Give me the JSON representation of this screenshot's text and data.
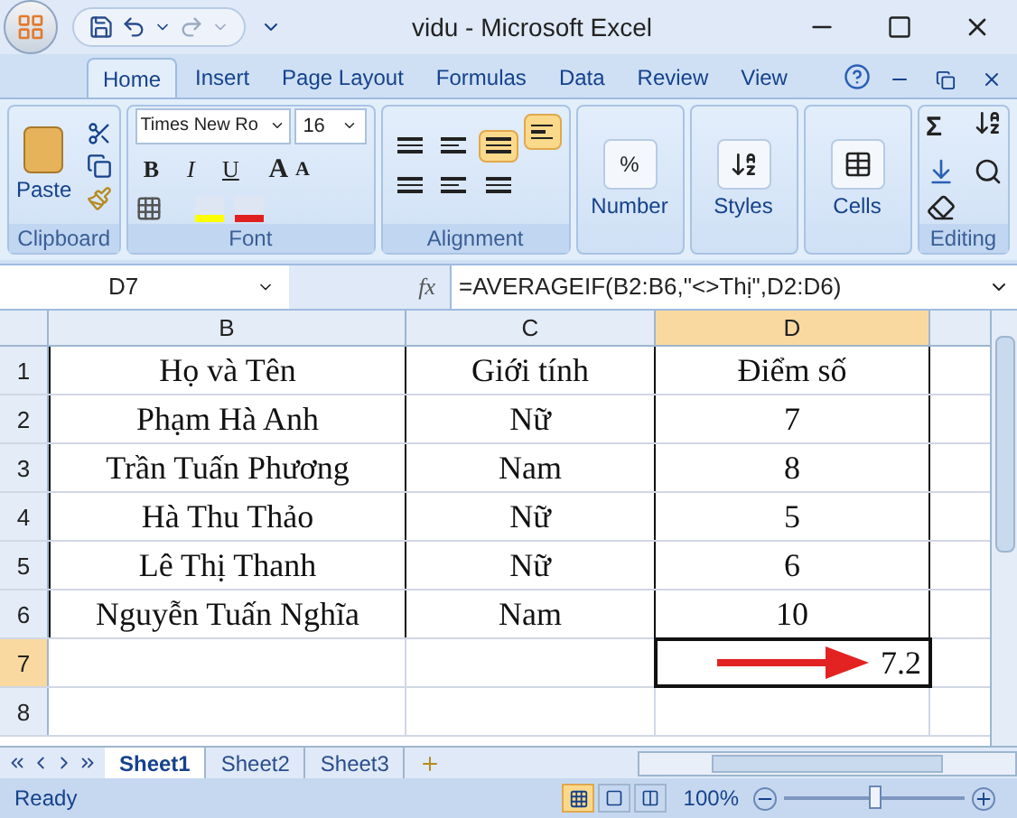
{
  "window": {
    "title": "vidu - Microsoft Excel"
  },
  "ribbon_tabs": [
    {
      "label": "Home",
      "selected": true
    },
    {
      "label": "Insert",
      "selected": false
    },
    {
      "label": "Page Layout",
      "selected": false
    },
    {
      "label": "Formulas",
      "selected": false
    },
    {
      "label": "Data",
      "selected": false
    },
    {
      "label": "Review",
      "selected": false
    },
    {
      "label": "View",
      "selected": false
    }
  ],
  "ribbon": {
    "clipboard": {
      "label": "Clipboard",
      "paste": "Paste"
    },
    "font": {
      "label": "Font",
      "font_name": "Times New Ro",
      "font_size": "16",
      "bold": "B",
      "italic": "I",
      "underline": "U",
      "grow": "A",
      "shrink": "A"
    },
    "alignment": {
      "label": "Alignment",
      "buttons": [
        {
          "selected": false
        },
        {
          "selected": false
        },
        {
          "selected": true
        },
        {
          "selected": false
        },
        {
          "selected": false
        },
        {
          "selected": false
        }
      ],
      "wrap_text": {
        "selected": true
      }
    },
    "number": {
      "label": "Number",
      "symbol": "%"
    },
    "styles": {
      "label": "Styles"
    },
    "cells": {
      "label": "Cells"
    },
    "editing": {
      "label": "Editing",
      "sum": "Σ"
    }
  },
  "formula_bar": {
    "name_box": "D7",
    "fx": "fx",
    "formula": "=AVERAGEIF(B2:B6,\"<>Thị\",D2:D6)"
  },
  "columns": [
    {
      "label": "B",
      "selected": false
    },
    {
      "label": "C",
      "selected": false
    },
    {
      "label": "D",
      "selected": true
    }
  ],
  "rows": [
    {
      "header": "1",
      "selected": false,
      "cells": [
        "Họ và Tên",
        "Giới tính",
        "Điểm số"
      ]
    },
    {
      "header": "2",
      "selected": false,
      "cells": [
        "Phạm Hà Anh",
        "Nữ",
        "7"
      ]
    },
    {
      "header": "3",
      "selected": false,
      "cells": [
        "Trần Tuấn Phương",
        "Nam",
        "8"
      ]
    },
    {
      "header": "4",
      "selected": false,
      "cells": [
        "Hà Thu Thảo",
        "Nữ",
        "5"
      ]
    },
    {
      "header": "5",
      "selected": false,
      "cells": [
        "Lê Thị Thanh",
        "Nữ",
        "6"
      ]
    },
    {
      "header": "6",
      "selected": false,
      "cells": [
        "Nguyễn Tuấn Nghĩa",
        "Nam",
        "10"
      ]
    },
    {
      "header": "7",
      "selected": true,
      "cells": [
        "",
        "",
        "7.2"
      ]
    },
    {
      "header": "8",
      "selected": false,
      "cells": [
        "",
        "",
        ""
      ]
    }
  ],
  "sheet_tabs": [
    {
      "label": "Sheet1",
      "selected": true
    },
    {
      "label": "Sheet2",
      "selected": false
    },
    {
      "label": "Sheet3",
      "selected": false
    }
  ],
  "status_bar": {
    "status": "Ready",
    "zoom": "100%",
    "zoom_slider": {
      "level": 0.5
    },
    "view_buttons": [
      {
        "selected": true
      },
      {
        "selected": false
      },
      {
        "selected": false
      }
    ]
  }
}
